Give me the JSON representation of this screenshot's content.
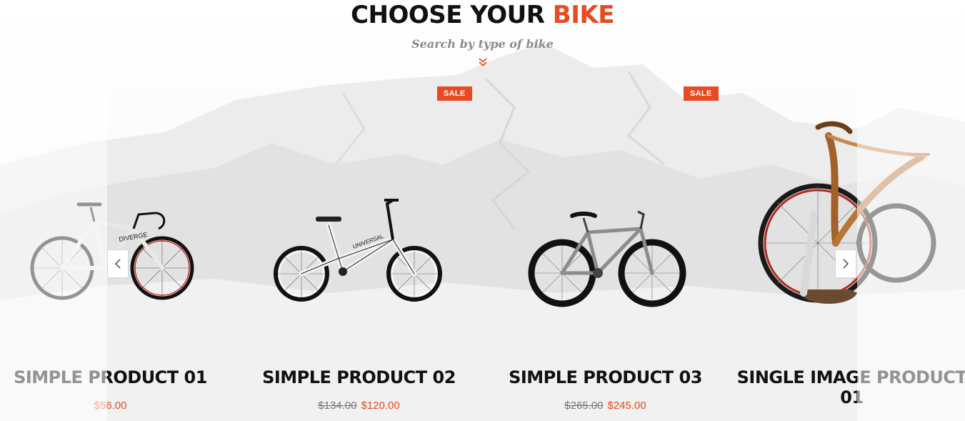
{
  "section": {
    "title_main": "CHOOSE YOUR ",
    "title_accent": "BIKE",
    "subtitle": "Search by type of bike",
    "chevron_icon": "double-chevron-down-icon"
  },
  "colors": {
    "accent": "#e84a22",
    "title": "#111111",
    "subtitle": "#8a8a8a"
  },
  "carousel": {
    "prev_icon": "chevron-left-icon",
    "next_icon": "chevron-right-icon"
  },
  "products": [
    {
      "name": "SIMPLE PRODUCT 01",
      "old_price": "",
      "price": "$56.00",
      "sale_badge": ""
    },
    {
      "name": "SIMPLE PRODUCT 02",
      "old_price": "$134.00",
      "price": "$120.00",
      "sale_badge": "SALE"
    },
    {
      "name": "SIMPLE PRODUCT 03",
      "old_price": "$265.00",
      "price": "$245.00",
      "sale_badge": "SALE"
    },
    {
      "name": "SINGLE IMAGE PRODUCT 01",
      "old_price": "",
      "price": "",
      "sale_badge": ""
    }
  ]
}
